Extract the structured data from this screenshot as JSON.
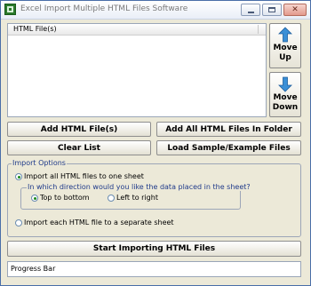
{
  "window": {
    "title": "Excel Import Multiple HTML Files Software",
    "controls": [
      "minimize",
      "maximize",
      "close"
    ]
  },
  "file_list": {
    "column_header": "HTML File(s)",
    "items": []
  },
  "move_buttons": {
    "up": {
      "line1": "Move",
      "line2": "Up",
      "icon": "arrow-up-icon"
    },
    "down": {
      "line1": "Move",
      "line2": "Down",
      "icon": "arrow-down-icon"
    }
  },
  "buttons": {
    "add_files": "Add HTML File(s)",
    "add_all_folder": "Add All HTML Files In Folder",
    "clear_list": "Clear List",
    "load_sample": "Load Sample/Example Files",
    "start": "Start Importing HTML Files"
  },
  "import_options": {
    "legend": "Import Options",
    "one_sheet_label": "Import all HTML files to one sheet",
    "one_sheet_selected": true,
    "direction": {
      "legend": "In which direction would you like the data placed in the sheet?",
      "top_to_bottom_label": "Top to bottom",
      "top_to_bottom_selected": true,
      "left_to_right_label": "Left to right",
      "left_to_right_selected": false
    },
    "separate_sheet_label": "Import each HTML file to a separate sheet",
    "separate_sheet_selected": false
  },
  "progress": {
    "label": "Progress Bar"
  },
  "colors": {
    "window_bg": "#ece9d8",
    "legend_text": "#1f3a8a",
    "arrow": "#3a8fd6",
    "radio_dot": "#1a8a1a"
  }
}
